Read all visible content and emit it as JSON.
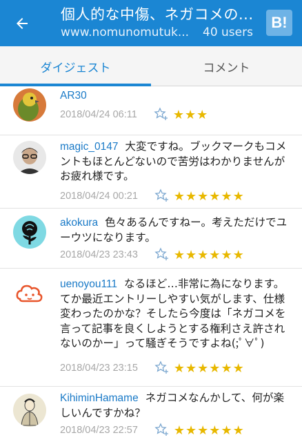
{
  "appbar": {
    "title": "個人的な中傷、ネガコメの...",
    "url": "www.nomunomutuk...",
    "users": "40 users",
    "b_label": "B!"
  },
  "tabs": {
    "digest": "ダイジェスト",
    "comments": "コメント"
  },
  "colors": {
    "primary": "#1b86d3",
    "username": "#1a7ac7",
    "star": "#e8b800"
  },
  "comments": [
    {
      "user": "AR30",
      "text": "",
      "date": "2018/04/24 06:11",
      "stars_text": "★★★",
      "stars": 3
    },
    {
      "user": "magic_0147",
      "text": "大変ですね。ブックマークもコメントもほとんどないので苦労はわかりませんがお疲れ様です。",
      "date": "2018/04/24 00:21",
      "stars_text": "★★★★★★",
      "stars": 6
    },
    {
      "user": "akokura",
      "text": "色々あるんですねー。考えただけでユーウツになります。",
      "date": "2018/04/23 23:43",
      "stars_text": "★★★★★★",
      "stars": 6
    },
    {
      "user": "uenoyou111",
      "text": "なるほど…非常に為になります。てか最近エントリーしやすい気がします、仕様変わったのかな？そしたら今度は「ネガコメを言って記事を良くしようとする権利さえ許されないのかー」って騒ぎそうですよね(;ﾟ∀ﾟ)",
      "date": "2018/04/23 23:15",
      "stars_text": "★★★★★★",
      "stars": 6
    },
    {
      "user": "KihiminHamame",
      "text": "ネガコメなんかして、何が楽しいんですかね？",
      "date": "2018/04/23 22:57",
      "stars_text": "★★★★★★",
      "stars": 6
    }
  ]
}
